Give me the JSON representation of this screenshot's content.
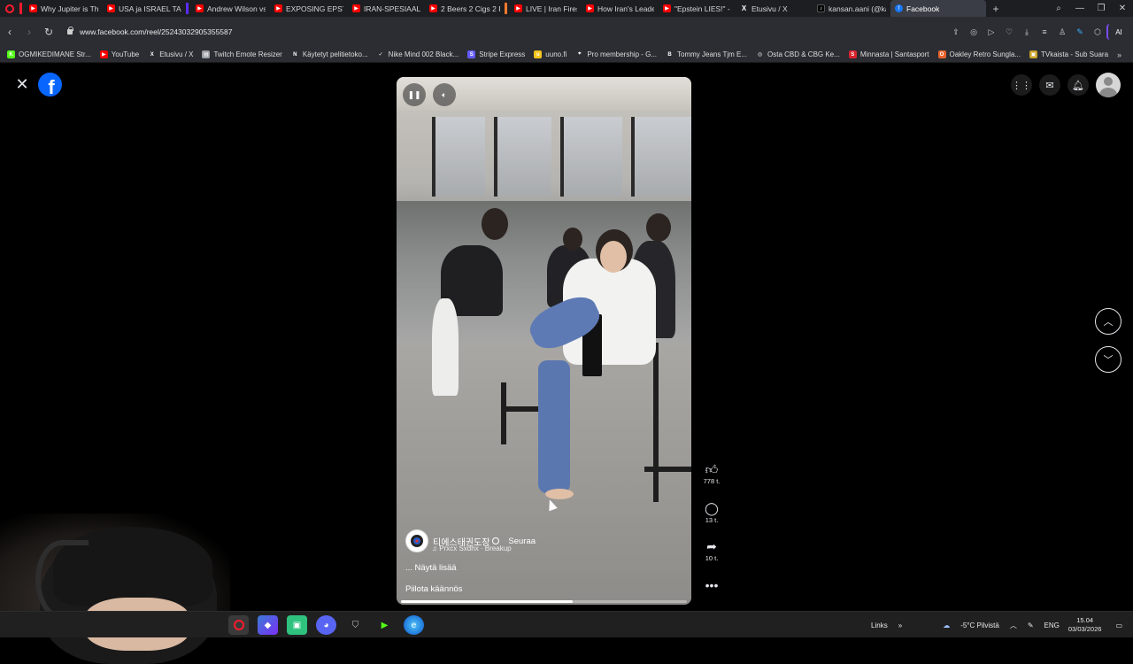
{
  "browser": {
    "tabs": [
      {
        "title": "Why Jupiter is The",
        "icon": "youtube-icon",
        "sep": "#ff1b2d"
      },
      {
        "title": "USA ja ISRAEL TAPP",
        "icon": "youtube-icon",
        "sep": ""
      },
      {
        "title": "Andrew Wilson vs.",
        "icon": "youtube-icon",
        "sep": "#5b2cff"
      },
      {
        "title": "EXPOSING EPSTEIN",
        "icon": "youtube-icon",
        "sep": ""
      },
      {
        "title": "IRAN-SPESIAALI: Tr",
        "icon": "youtube-icon",
        "sep": ""
      },
      {
        "title": "2 Beers 2 Cigs 2 Ru",
        "icon": "youtube-icon",
        "sep": ""
      },
      {
        "title": "LIVE | Iran Fires Fou",
        "icon": "youtube-icon",
        "sep": "#ff7a2d"
      },
      {
        "title": "How Iran's Leader",
        "icon": "youtube-icon",
        "sep": ""
      },
      {
        "title": "\"Epstein LIES!\" - CU",
        "icon": "youtube-icon",
        "sep": ""
      },
      {
        "title": "Etusivu / X",
        "icon": "x-icon",
        "sep": ""
      },
      {
        "title": "kansan.aani (@kar",
        "icon": "tiktok-icon",
        "sep": ""
      },
      {
        "title": "Facebook",
        "icon": "facebook-icon",
        "sep": "",
        "active": true
      }
    ],
    "url": "www.facebook.com/reel/25243032905355587",
    "ai_label": "AI",
    "bookmarks": [
      {
        "label": "OGMIKEDIMANE Str...",
        "color": "#53fc18",
        "glyph": "K"
      },
      {
        "label": "YouTube",
        "color": "#ff0000",
        "glyph": "▶"
      },
      {
        "label": "Etusivu / X",
        "color": "transparent",
        "glyph": "X"
      },
      {
        "label": "Twitch Emote Resizer",
        "color": "#9aa0a6",
        "glyph": "▤"
      },
      {
        "label": "Käytetyt pelitietoko...",
        "color": "transparent",
        "glyph": "N"
      },
      {
        "label": "Nike Mind 002 Black...",
        "color": "transparent",
        "glyph": "✓"
      },
      {
        "label": "Stripe Express",
        "color": "#635bff",
        "glyph": "S"
      },
      {
        "label": "uuno.fi",
        "color": "#f5c518",
        "glyph": "u"
      },
      {
        "label": "Pro membership - G...",
        "color": "transparent",
        "glyph": "⌖"
      },
      {
        "label": "Tommy Jeans Tjm E...",
        "color": "transparent",
        "glyph": "B"
      },
      {
        "label": "Osta CBD & CBG Ke...",
        "color": "transparent",
        "glyph": "◎"
      },
      {
        "label": "Minnasta | Santasport",
        "color": "#d9232d",
        "glyph": "S"
      },
      {
        "label": "Oakley Retro Sunglа...",
        "color": "#e8632b",
        "glyph": "O"
      },
      {
        "label": "TVkaista - Sub Suara",
        "color": "#c9a227",
        "glyph": "▣"
      }
    ]
  },
  "reel": {
    "author": "티에스태권도장",
    "follow_label": "Seuraa",
    "music": "Prxcx Sxdhx · Breakup",
    "see_more": "... Näytä lisää",
    "hide_translation": "Piilota käännös",
    "likes": "778 t.",
    "comments": "13 t.",
    "shares": "10 t.",
    "progress": 0.6
  },
  "taskbar": {
    "links_label": "Links",
    "weather": "-5°C  Pilvistä",
    "language": "ENG",
    "time": "15.04",
    "date": "03/03/2026"
  },
  "colors": {
    "facebook_blue": "#0866ff",
    "opera_red": "#ff1b2d"
  }
}
